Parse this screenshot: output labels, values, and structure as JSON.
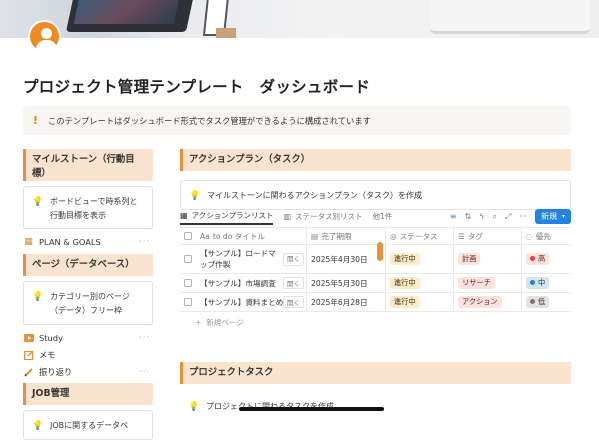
{
  "page": {
    "title": "プロジェクト管理テンプレート　ダッシュボード",
    "callout": "このテンプレートはダッシュボード形式でタスク管理ができるように構成されています",
    "colors": {
      "accent": "#e8913d",
      "section_bg": "#fbe4cf",
      "primary": "#2383e2"
    }
  },
  "sidebar": {
    "milestone_heading": "マイルストーン（行動目標）",
    "milestone_card": "ボードビューで時系列と行動目標を表示",
    "plan_goals": "PLAN & GOALS",
    "pages_heading": "ページ（データベース）",
    "pages_card": "カテゴリー別のページ（データ）フリー枠",
    "nav": [
      {
        "label": "Study",
        "icon": "play-icon"
      },
      {
        "label": "メモ",
        "icon": "edit-icon"
      },
      {
        "label": "振り返り",
        "icon": "pencil-icon"
      }
    ],
    "job_heading": "JOB管理",
    "job_card": "JOBに関するデータベ"
  },
  "action": {
    "heading": "アクションプラン（タスク）",
    "callout": "マイルストーンに関わるアクションプラン（タスク）を作成",
    "tabs": [
      "アクションプランリスト",
      "ステータス別リスト",
      "他1件"
    ],
    "new_button": "新規",
    "columns": [
      "to do タイトル",
      "完了期限",
      "ステータス",
      "タグ",
      "優先"
    ],
    "rows": [
      {
        "title": "【サンプル】ロードマップ作製",
        "open": "開く",
        "date": "2025年4月30日",
        "status": "進行中",
        "tag": "計画",
        "tag_color": "red",
        "priority": "高",
        "priority_color": "#e03e3e"
      },
      {
        "title": "【サンプル】市場調査",
        "open": "開く",
        "date": "2025年5月30日",
        "status": "進行中",
        "tag": "リサーチ",
        "tag_color": "red",
        "priority": "中",
        "priority_color": "#2e7ec7"
      },
      {
        "title": "【サンプル】資料まとめ",
        "open": "開く",
        "date": "2025年6月28日",
        "status": "進行中",
        "tag": "アクション",
        "tag_color": "red",
        "priority": "低",
        "priority_color": "#787774"
      }
    ],
    "new_page": "新規ページ"
  },
  "project": {
    "heading": "プロジェクトタスク",
    "callout": "プロジェクトに関わるタスクを作成"
  }
}
